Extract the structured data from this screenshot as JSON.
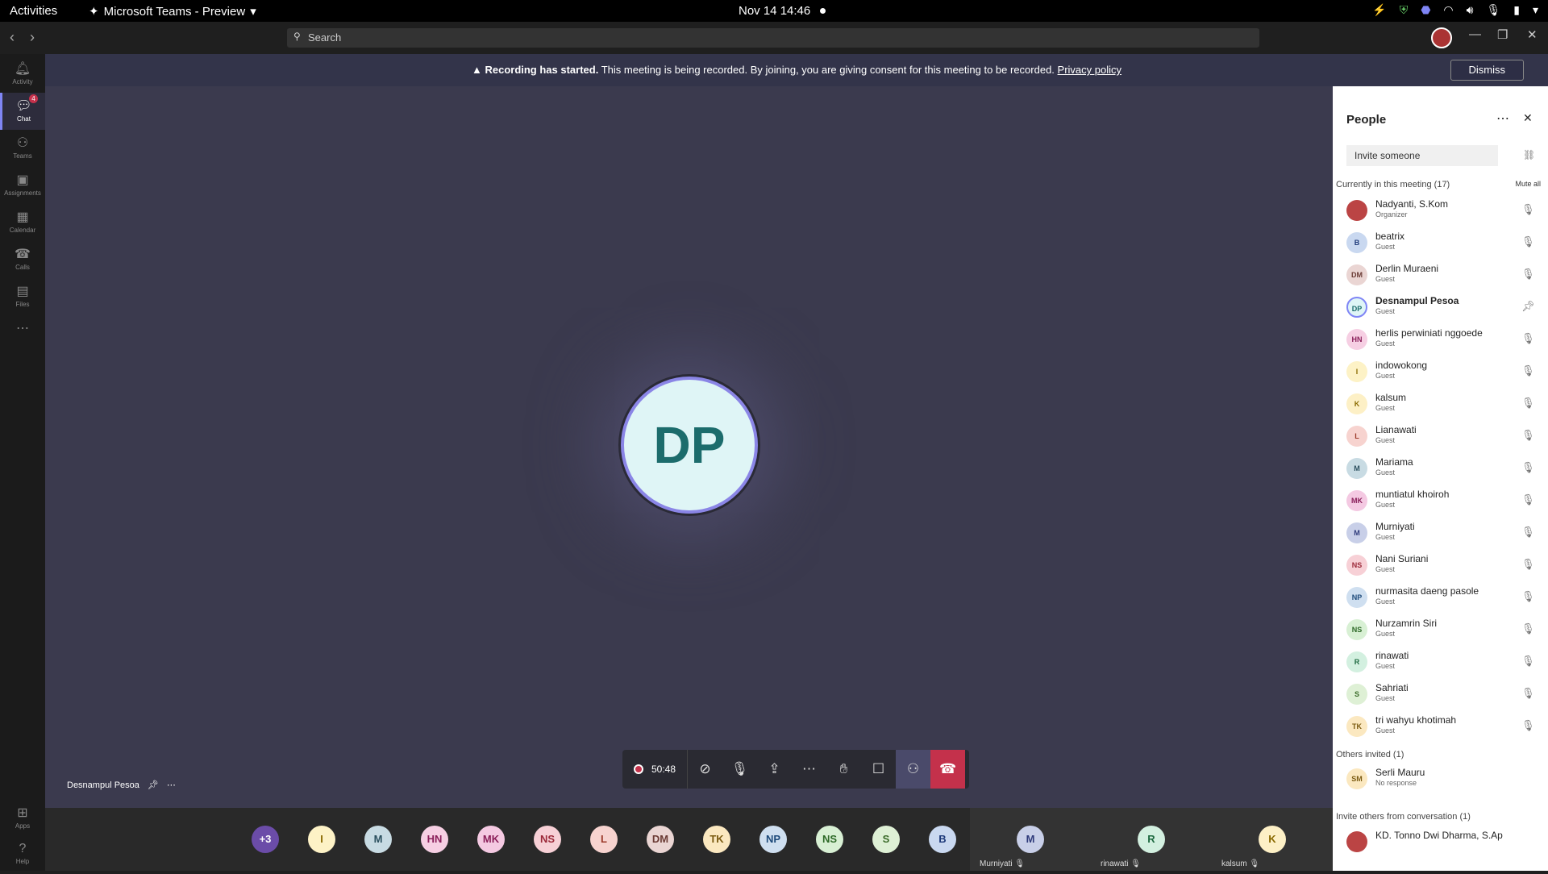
{
  "gnome": {
    "activities": "Activities",
    "app": "Microsoft Teams - Preview",
    "clock": "Nov 14  14:46"
  },
  "search": {
    "placeholder": "Search"
  },
  "rail": [
    {
      "label": "Activity",
      "icon": "bell-icon"
    },
    {
      "label": "Chat",
      "icon": "chat-icon",
      "badge": "4",
      "active": true
    },
    {
      "label": "Teams",
      "icon": "teams-icon"
    },
    {
      "label": "Assignments",
      "icon": "assignments-icon"
    },
    {
      "label": "Calendar",
      "icon": "calendar-icon"
    },
    {
      "label": "Calls",
      "icon": "phone-icon"
    },
    {
      "label": "Files",
      "icon": "files-icon"
    },
    {
      "label": "",
      "icon": "more-icon"
    }
  ],
  "rail_bottom": [
    {
      "label": "Apps",
      "icon": "apps-icon"
    },
    {
      "label": "Help",
      "icon": "help-icon"
    }
  ],
  "banner": {
    "strong": "Recording has started.",
    "text": " This meeting is being recorded. By joining, you are giving consent for this meeting to be recorded. ",
    "link": "Privacy policy",
    "dismiss": "Dismiss"
  },
  "stage": {
    "initials": "DP",
    "speaker": "Desnampul Pesoa"
  },
  "controls": {
    "timer": "50:48"
  },
  "strip": {
    "avatars": [
      {
        "t": "+3",
        "bg": "#6b4ca8",
        "fg": "#fff"
      },
      {
        "t": "I",
        "bg": "#fdf2c6",
        "fg": "#8a6a00"
      },
      {
        "t": "M",
        "bg": "#c8dbe3",
        "fg": "#2b4f5e"
      },
      {
        "t": "HN",
        "bg": "#f6cfe3",
        "fg": "#8a1f5a"
      },
      {
        "t": "MK",
        "bg": "#f4c9e2",
        "fg": "#8a1f5a"
      },
      {
        "t": "NS",
        "bg": "#f7d0d6",
        "fg": "#9c2a3a"
      },
      {
        "t": "L",
        "bg": "#f7d3cf",
        "fg": "#9c3a2a"
      },
      {
        "t": "DM",
        "bg": "#ead5d3",
        "fg": "#6a3a34"
      },
      {
        "t": "TK",
        "bg": "#fbe8c0",
        "fg": "#7a5a10"
      },
      {
        "t": "NP",
        "bg": "#cfdff0",
        "fg": "#1e4a7a"
      },
      {
        "t": "NS",
        "bg": "#d8f0d4",
        "fg": "#2e6a28"
      },
      {
        "t": "S",
        "bg": "#def0d5",
        "fg": "#3a6a28"
      },
      {
        "t": "B",
        "bg": "#c9d8f0",
        "fg": "#1e3a7a"
      }
    ],
    "tiles": [
      {
        "t": "M",
        "name": "Murniyati",
        "bg": "#c8cfe8",
        "fg": "#2e3a7a"
      },
      {
        "t": "R",
        "name": "rinawati",
        "bg": "#d3f0e0",
        "fg": "#1e6a40"
      },
      {
        "t": "K",
        "name": "kalsum",
        "bg": "#fdf0c6",
        "fg": "#8a6a00"
      }
    ]
  },
  "people": {
    "title": "People",
    "invite": "Invite someone",
    "section1": "Currently in this meeting (17)",
    "mute_all": "Mute all",
    "members": [
      {
        "i": "",
        "name": "Nadyanti, S.Kom",
        "role": "Organizer",
        "bg": "#b44",
        "fg": "#fff",
        "photo": true
      },
      {
        "i": "B",
        "name": "beatrix",
        "role": "Guest",
        "bg": "#c9d8f0",
        "fg": "#1e3a7a"
      },
      {
        "i": "DM",
        "name": "Derlin Muraeni",
        "role": "Guest",
        "bg": "#ead5d3",
        "fg": "#6a3a34"
      },
      {
        "i": "DP",
        "name": "Desnampul Pesoa",
        "role": "Guest",
        "bg": "#dff5f6",
        "fg": "#1c6c6c",
        "bold": true
      },
      {
        "i": "HN",
        "name": "herlis perwiniati nggoede",
        "role": "Guest",
        "bg": "#f6cfe3",
        "fg": "#8a1f5a"
      },
      {
        "i": "I",
        "name": "indowokong",
        "role": "Guest",
        "bg": "#fdf2c6",
        "fg": "#8a6a00"
      },
      {
        "i": "K",
        "name": "kalsum",
        "role": "Guest",
        "bg": "#fdf0c6",
        "fg": "#8a6a00"
      },
      {
        "i": "L",
        "name": "Lianawati",
        "role": "Guest",
        "bg": "#f7d3cf",
        "fg": "#9c3a2a"
      },
      {
        "i": "M",
        "name": "Mariama",
        "role": "Guest",
        "bg": "#c8dbe3",
        "fg": "#2b4f5e"
      },
      {
        "i": "MK",
        "name": "muntiatul khoiroh",
        "role": "Guest",
        "bg": "#f4c9e2",
        "fg": "#8a1f5a"
      },
      {
        "i": "M",
        "name": "Murniyati",
        "role": "Guest",
        "bg": "#c8cfe8",
        "fg": "#2e3a7a"
      },
      {
        "i": "NS",
        "name": "Nani Suriani",
        "role": "Guest",
        "bg": "#f7d0d6",
        "fg": "#9c2a3a"
      },
      {
        "i": "NP",
        "name": "nurmasita daeng pasole",
        "role": "Guest",
        "bg": "#cfdff0",
        "fg": "#1e4a7a"
      },
      {
        "i": "NS",
        "name": "Nurzamrin Siri",
        "role": "Guest",
        "bg": "#d8f0d4",
        "fg": "#2e6a28"
      },
      {
        "i": "R",
        "name": "rinawati",
        "role": "Guest",
        "bg": "#d3f0e0",
        "fg": "#1e6a40"
      },
      {
        "i": "S",
        "name": "Sahriati",
        "role": "Guest",
        "bg": "#def0d5",
        "fg": "#3a6a28"
      },
      {
        "i": "TK",
        "name": "tri wahyu khotimah",
        "role": "Guest",
        "bg": "#fbe8c0",
        "fg": "#7a5a10"
      }
    ],
    "section2": "Others invited (1)",
    "invited": [
      {
        "i": "SM",
        "name": "Serli Mauru",
        "role": "No response",
        "bg": "#fbe8c0",
        "fg": "#7a5a10"
      }
    ],
    "section3": "Invite others from conversation (1)",
    "others": [
      {
        "i": "",
        "name": "KD. Tonno Dwi Dharma, S.Ap",
        "role": "",
        "bg": "#b44",
        "fg": "#fff",
        "photo": true
      }
    ]
  }
}
